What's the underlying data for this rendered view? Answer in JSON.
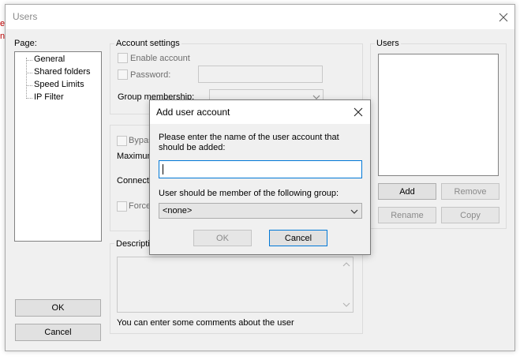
{
  "background_fragments": [
    "e",
    "n."
  ],
  "window": {
    "title": "Users",
    "page_label": "Page:",
    "pages": [
      "General",
      "Shared folders",
      "Speed Limits",
      "IP Filter"
    ],
    "ok_label": "OK",
    "cancel_label": "Cancel"
  },
  "account_settings": {
    "title": "Account settings",
    "enable_account": "Enable account",
    "password": "Password:",
    "group_membership": "Group membership:"
  },
  "limits": {
    "bypass": "Bypas",
    "maximum": "Maximum",
    "connections": "Connectic",
    "force": "Force"
  },
  "description": {
    "title": "Descriptio",
    "hint": "You can enter some comments about the user"
  },
  "users_panel": {
    "title": "Users",
    "add": "Add",
    "remove": "Remove",
    "rename": "Rename",
    "copy": "Copy"
  },
  "dialog": {
    "title": "Add user account",
    "prompt": "Please enter the name of the user account that should be added:",
    "username_value": "",
    "group_label": "User should be member of the following group:",
    "group_selected": "<none>",
    "ok_label": "OK",
    "cancel_label": "Cancel"
  },
  "colors": {
    "accent": "#0078d7",
    "fragment_text": "#c00000"
  }
}
